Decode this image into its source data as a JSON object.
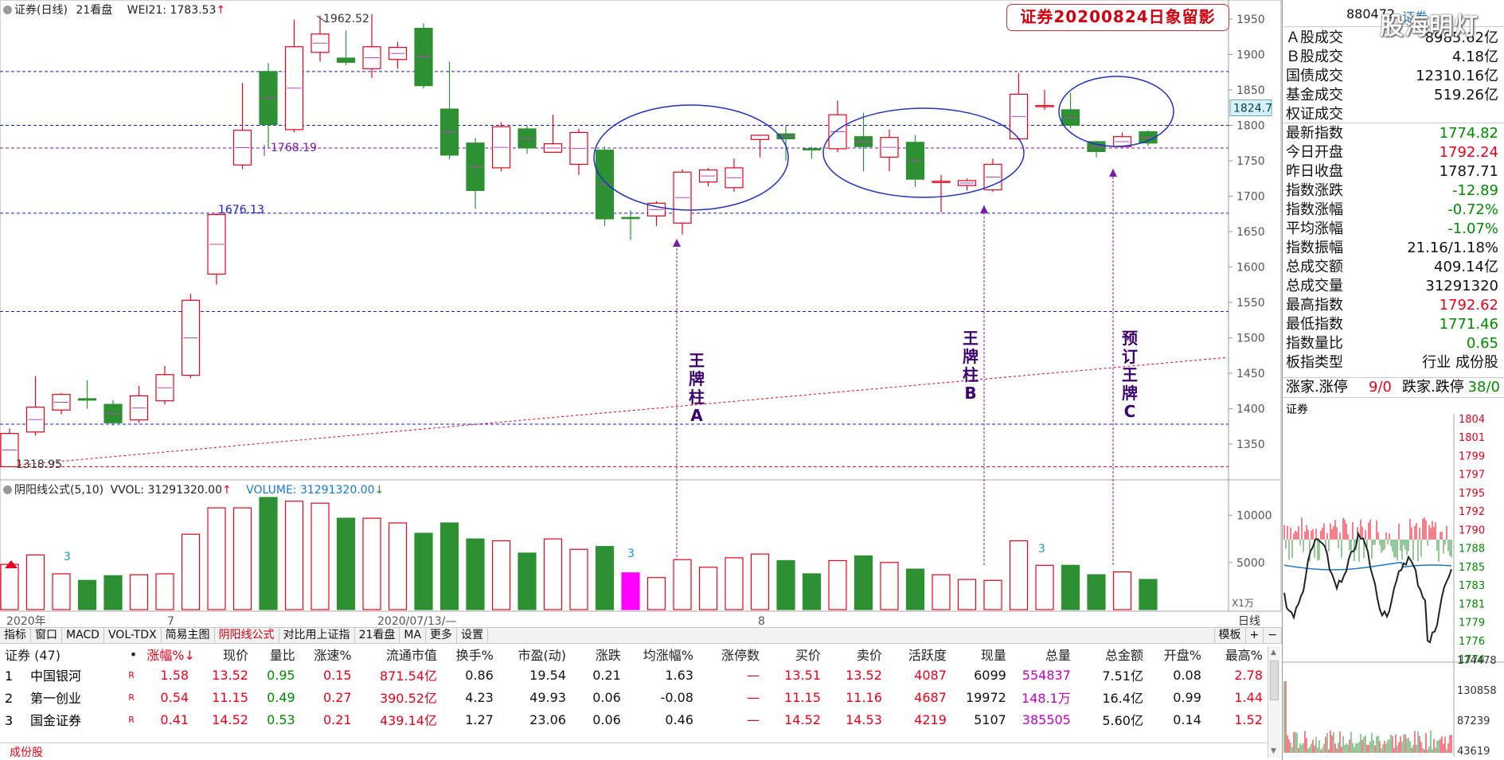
{
  "header": {
    "title": "证券(日线)",
    "board": "21看盘",
    "wei_label": "WEI21: 1783.53",
    "wei_arrow": "↑"
  },
  "annotation": {
    "title": "证券20200824日象留影",
    "label_a": [
      "王",
      "牌",
      "柱",
      "A"
    ],
    "label_b": [
      "王",
      "牌",
      "柱",
      "B"
    ],
    "label_c": [
      "预",
      "订",
      "王",
      "牌",
      "C"
    ]
  },
  "chart_data": {
    "type": "candlestick",
    "price_axis": {
      "ticks": [
        1350,
        1400,
        1450,
        1500,
        1550,
        1600,
        1650,
        1700,
        1750,
        1800,
        1850,
        1900,
        1950
      ],
      "ylim": [
        1305,
        1968
      ]
    },
    "current_price_label": "1824.7",
    "price_annotations": [
      {
        "text": "1962.52",
        "price": 1962.52
      },
      {
        "text": "1768.19",
        "price": 1768.19
      },
      {
        "text": "1676.13",
        "price": 1676.13
      },
      {
        "text": "1318.95",
        "price": 1318.95
      }
    ],
    "horizontal_levels": [
      1876,
      1800,
      1768,
      1676,
      1537,
      1378,
      1318
    ],
    "candles": [
      {
        "o": 1318,
        "c": 1365,
        "h": 1372,
        "l": 1318
      },
      {
        "o": 1367,
        "c": 1402,
        "h": 1446,
        "l": 1362
      },
      {
        "o": 1398,
        "c": 1420,
        "h": 1422,
        "l": 1392
      },
      {
        "o": 1414,
        "c": 1412,
        "h": 1440,
        "l": 1400
      },
      {
        "o": 1406,
        "c": 1380,
        "h": 1412,
        "l": 1376
      },
      {
        "o": 1384,
        "c": 1418,
        "h": 1432,
        "l": 1380
      },
      {
        "o": 1411,
        "c": 1448,
        "h": 1460,
        "l": 1406
      },
      {
        "o": 1447,
        "c": 1553,
        "h": 1562,
        "l": 1443
      },
      {
        "o": 1590,
        "c": 1674,
        "h": 1676,
        "l": 1575
      },
      {
        "o": 1744,
        "c": 1793,
        "h": 1860,
        "l": 1738
      },
      {
        "o": 1876,
        "c": 1801,
        "h": 1888,
        "l": 1768
      },
      {
        "o": 1794,
        "c": 1911,
        "h": 1949,
        "l": 1790
      },
      {
        "o": 1903,
        "c": 1929,
        "h": 1955,
        "l": 1890
      },
      {
        "o": 1895,
        "c": 1889,
        "h": 1934,
        "l": 1885
      },
      {
        "o": 1880,
        "c": 1911,
        "h": 1957,
        "l": 1867
      },
      {
        "o": 1893,
        "c": 1910,
        "h": 1918,
        "l": 1880
      },
      {
        "o": 1937,
        "c": 1856,
        "h": 1944,
        "l": 1852
      },
      {
        "o": 1823,
        "c": 1758,
        "h": 1890,
        "l": 1752
      },
      {
        "o": 1775,
        "c": 1708,
        "h": 1782,
        "l": 1682
      },
      {
        "o": 1740,
        "c": 1798,
        "h": 1804,
        "l": 1735
      },
      {
        "o": 1795,
        "c": 1768,
        "h": 1800,
        "l": 1760
      },
      {
        "o": 1762,
        "c": 1774,
        "h": 1815,
        "l": 1762
      },
      {
        "o": 1745,
        "c": 1790,
        "h": 1795,
        "l": 1730
      },
      {
        "o": 1765,
        "c": 1668,
        "h": 1770,
        "l": 1658
      },
      {
        "o": 1670,
        "c": 1669,
        "h": 1680,
        "l": 1638
      },
      {
        "o": 1672,
        "c": 1690,
        "h": 1693,
        "l": 1658
      },
      {
        "o": 1662,
        "c": 1734,
        "h": 1738,
        "l": 1646
      },
      {
        "o": 1720,
        "c": 1737,
        "h": 1740,
        "l": 1714
      },
      {
        "o": 1712,
        "c": 1740,
        "h": 1753,
        "l": 1706
      },
      {
        "o": 1780,
        "c": 1786,
        "h": 1787,
        "l": 1755
      },
      {
        "o": 1788,
        "c": 1781,
        "h": 1800,
        "l": 1750
      },
      {
        "o": 1767,
        "c": 1766,
        "h": 1770,
        "l": 1753
      },
      {
        "o": 1767,
        "c": 1815,
        "h": 1835,
        "l": 1762
      },
      {
        "o": 1784,
        "c": 1770,
        "h": 1818,
        "l": 1735
      },
      {
        "o": 1755,
        "c": 1783,
        "h": 1794,
        "l": 1735
      },
      {
        "o": 1776,
        "c": 1724,
        "h": 1786,
        "l": 1713
      },
      {
        "o": 1721,
        "c": 1721,
        "h": 1730,
        "l": 1677
      },
      {
        "o": 1715,
        "c": 1722,
        "h": 1725,
        "l": 1708
      },
      {
        "o": 1709,
        "c": 1745,
        "h": 1753,
        "l": 1706
      },
      {
        "o": 1781,
        "c": 1844,
        "h": 1874,
        "l": 1779
      },
      {
        "o": 1828,
        "c": 1828,
        "h": 1850,
        "l": 1822
      },
      {
        "o": 1822,
        "c": 1800,
        "h": 1846,
        "l": 1796
      },
      {
        "o": 1777,
        "c": 1763,
        "h": 1777,
        "l": 1755
      },
      {
        "o": 1770,
        "c": 1784,
        "h": 1790,
        "l": 1768
      },
      {
        "o": 1791,
        "c": 1775,
        "h": 1793,
        "l": 1771
      }
    ],
    "volume_panel": {
      "label": "阴阳线公式(5,10)",
      "wvol": "VVOL: 31291320.00",
      "wvol_arrow": "↑",
      "volume": "VOLUME: 31291320.00",
      "volume_arrow": "↓",
      "ticks": [
        5000,
        10000
      ],
      "tick_labels": [
        "5000",
        "10000"
      ],
      "unit_label": "X1万",
      "count_marks": [
        "3",
        "3",
        "3"
      ],
      "values": [
        4800,
        5800,
        3800,
        3100,
        3600,
        3700,
        3800,
        8000,
        10800,
        10800,
        11900,
        11500,
        11300,
        9700,
        9700,
        9200,
        8100,
        9200,
        7500,
        7300,
        6000,
        7500,
        6400,
        6700,
        3900,
        3400,
        5300,
        4500,
        5500,
        5900,
        5200,
        3800,
        5200,
        5700,
        5000,
        4300,
        3700,
        3200,
        3100,
        7300,
        4700,
        4700,
        3700,
        4000,
        3200
      ]
    },
    "date_axis": {
      "labels": [
        "2020年",
        "7",
        "2020/07/13/—",
        "8"
      ],
      "period": "日线"
    }
  },
  "toolbar": {
    "items": [
      "指标",
      "窗口",
      "MACD",
      "VOL-TDX",
      "简易主图",
      "阴阳线公式",
      "对比用上证指",
      "21看盘",
      "MA",
      "更多",
      "设置"
    ],
    "active": "阴阳线公式",
    "right_items": [
      "模板",
      "+",
      "−"
    ]
  },
  "table": {
    "headers": [
      "证券 (47)",
      "•",
      "涨幅%↓",
      "现价",
      "量比",
      "涨速%",
      "流通市值",
      "换手%",
      "市盈(动)",
      "涨跌",
      "均涨幅%",
      "涨停数",
      "买价",
      "卖价",
      "活跃度",
      "现量",
      "总量",
      "总金额",
      "开盘%",
      "最高%"
    ],
    "rows": [
      [
        "1",
        "中国银河",
        "R",
        "1.58",
        "13.52",
        "0.95",
        "0.15",
        "871.54亿",
        "0.86",
        "19.54",
        "0.21",
        "1.63",
        "—",
        "13.51",
        "13.52",
        "4087",
        "6099",
        "554837",
        "7.51亿",
        "0.08",
        "2.78"
      ],
      [
        "2",
        "第一创业",
        "R",
        "0.54",
        "11.15",
        "0.49",
        "0.27",
        "390.52亿",
        "4.23",
        "49.93",
        "0.06",
        "-0.08",
        "—",
        "11.15",
        "11.16",
        "4687",
        "19972",
        "148.1万",
        "16.4亿",
        "0.99",
        "1.44"
      ],
      [
        "3",
        "国金证券",
        "R",
        "0.41",
        "14.52",
        "0.53",
        "0.21",
        "439.14亿",
        "1.27",
        "23.06",
        "0.06",
        "0.46",
        "—",
        "14.52",
        "14.53",
        "4219",
        "5107",
        "385505",
        "5.60亿",
        "0.14",
        "1.52"
      ]
    ]
  },
  "bottom_tab": "成份股",
  "right_panel": {
    "code": "880472",
    "name": "证券",
    "logo": "股海明灯",
    "rows": [
      {
        "k": "Ａ股成交",
        "v": "8985.62亿",
        "c": "blk"
      },
      {
        "k": "Ｂ股成交",
        "v": "4.18亿",
        "c": "blk"
      },
      {
        "k": "国债成交",
        "v": "12310.16亿",
        "c": "blk"
      },
      {
        "k": "基金成交",
        "v": "519.26亿",
        "c": "blk"
      },
      {
        "k": "权证成交",
        "v": "",
        "c": "blk"
      },
      {
        "k": "最新指数",
        "v": "1774.82",
        "c": "grn"
      },
      {
        "k": "今日开盘",
        "v": "1792.24",
        "c": "red"
      },
      {
        "k": "昨日收盘",
        "v": "1787.71",
        "c": "blk"
      },
      {
        "k": "指数涨跌",
        "v": "-12.89",
        "c": "grn"
      },
      {
        "k": "指数涨幅",
        "v": "-0.72%",
        "c": "grn"
      },
      {
        "k": "平均涨幅",
        "v": "-1.07%",
        "c": "grn"
      },
      {
        "k": "指数振幅",
        "v": "21.16/1.18%",
        "c": "blk"
      },
      {
        "k": "总成交额",
        "v": "409.14亿",
        "c": "blk"
      },
      {
        "k": "总成交量",
        "v": "31291320",
        "c": "blk"
      },
      {
        "k": "最高指数",
        "v": "1792.62",
        "c": "red"
      },
      {
        "k": "最低指数",
        "v": "1771.46",
        "c": "grn"
      },
      {
        "k": "指数量比",
        "v": "0.65",
        "c": "grn"
      },
      {
        "k": "板指类型",
        "v": "行业 成份股",
        "c": "blk"
      }
    ],
    "updown": {
      "up_label": "涨家.涨停",
      "up_val": "9/0",
      "down_label": "跌家.跌停",
      "down_val": "38/0"
    },
    "mini_title": "证券",
    "mini_ticks": [
      "1804",
      "1801",
      "1799",
      "1797",
      "1795",
      "1792",
      "1790",
      "1788",
      "1785",
      "1783",
      "1781",
      "1779",
      "1776",
      "1774"
    ],
    "mini_vol_ticks": [
      "174478",
      "130858",
      "87239",
      "43619"
    ]
  },
  "colors": {
    "up": "#e8001c",
    "down": "#2d9133",
    "level": "#1a1acc",
    "purple": "#7a1aa8"
  }
}
